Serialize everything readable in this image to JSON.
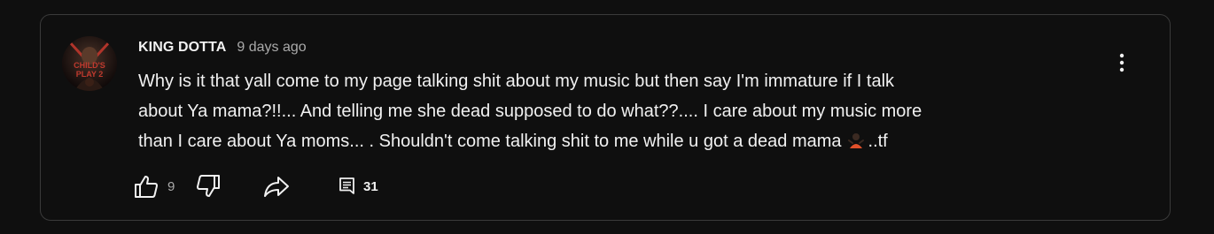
{
  "comment": {
    "author": "KING DOTTA",
    "timestamp": "9 days ago",
    "text_lines": [
      "Why is it that yall come to my page talking shit about my music but then say I'm immature if I talk",
      "about Ya mama?!!... And telling me she dead supposed to do what??.... I care about my music more",
      "than I care about Ya moms... . Shouldn't come talking shit to me while u got a dead mama"
    ],
    "text_tail": "..tf",
    "avatar_text": "CHILD'S PLAY 2",
    "icons": {
      "avatar": "profile-avatar",
      "emoji": "person-gesturing-emoji",
      "menu": "more-vertical-icon",
      "like": "thumbs-up-icon",
      "dislike": "thumbs-down-icon",
      "share": "share-arrow-icon",
      "replies": "comment-icon"
    }
  },
  "actions": {
    "like_count": "9",
    "replies_count": "31"
  },
  "colors": {
    "background": "#0f0f0f",
    "border": "#3a3a3a",
    "text_primary": "#f1f1f1",
    "text_secondary": "#aaaaaa"
  }
}
